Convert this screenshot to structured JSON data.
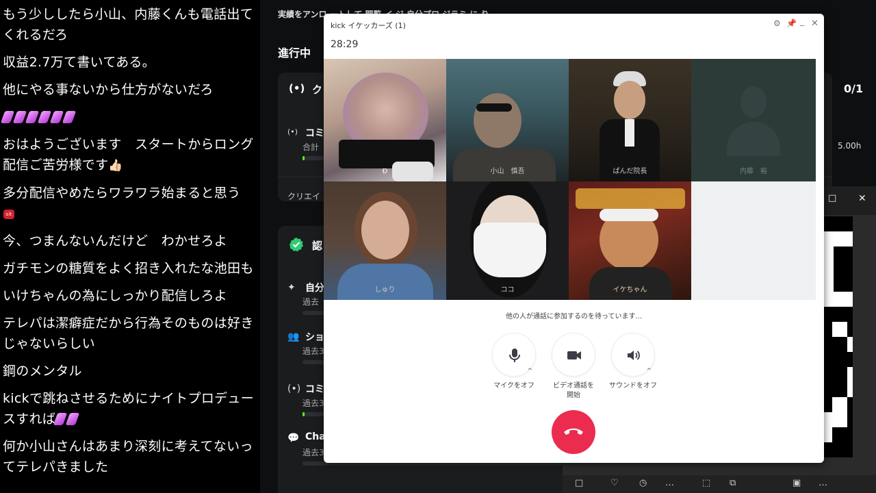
{
  "chat": {
    "messages": [
      {
        "text": "もう少ししたら小山、内藤くんも電話出てくれるだろ"
      },
      {
        "text": "収益2.7万て書いてある。"
      },
      {
        "text": "他にやる事ないから仕方がないだろ"
      },
      {
        "text": "",
        "emotes": 6
      },
      {
        "text": "おはようございます　スタートからロング配信ご苦労様です",
        "suffix": "👍🏻"
      },
      {
        "text": "多分配信やめたらワラワラ始まると思う",
        "badge": "sit"
      },
      {
        "text": "今、つまんないんだけど　わかせろよ"
      },
      {
        "text": "ガチモンの糖質をよく招き入れたな池田も"
      },
      {
        "text": "いけちゃんの為にしっかり配信しろよ"
      },
      {
        "text": "テレパは潔癖症だから行為そのものは好きじゃないらしい"
      },
      {
        "text": "鋼のメンタル"
      },
      {
        "text": "kickで跳ねさせるためにナイトプロデュースすれば",
        "trailing_emotes": 2
      },
      {
        "text": "何か小山さんはあまり深刻に考えてないってテレパきました"
      }
    ]
  },
  "dashboard": {
    "top_text": "実績をアンロ ートして 閲覧 イ ジ 自分プロ ジラミ に り",
    "section_title": "進行中",
    "card1": {
      "title_icon": "(•)",
      "title": "ク",
      "right": "0/1",
      "row_icon": "(•)",
      "row_label": "コミ",
      "row_sub": "合計",
      "row_right": "5.00h",
      "footer": "クリエイ"
    },
    "card2": {
      "title": "認",
      "rows": [
        {
          "icon": "✦",
          "label": "自分",
          "sub": "過去"
        },
        {
          "icon": "👥",
          "label": "ショ",
          "sub": "過去3"
        },
        {
          "icon": "(•)",
          "label": "コミ",
          "sub": "過去3"
        },
        {
          "icon": "💬",
          "label": "Chat",
          "sub": "過去3"
        }
      ]
    }
  },
  "call": {
    "title": "kick イケッカーズ  (1)",
    "timer": "28:29",
    "participants": [
      {
        "name": "Ð"
      },
      {
        "name": "小山　慎吾"
      },
      {
        "name": "ぱんだ院長"
      },
      {
        "name": "内藤　裕"
      },
      {
        "name": "しゅり"
      },
      {
        "name": "ココ"
      },
      {
        "name": "イケちゃん"
      }
    ],
    "waiting_text": "他の人が通話に参加するのを待っています...",
    "controls": {
      "mic_label": "マイクをオフ",
      "video_label": "ビデオ通話を\n開始",
      "sound_label": "サウンドをオフ",
      "caret": "^"
    }
  },
  "qr_window": {
    "maximize": "□",
    "close": "✕",
    "bottom_icons": [
      "□",
      "♡",
      "◷",
      "…",
      "⬚",
      "⧉",
      "▣",
      "…"
    ]
  },
  "colors": {
    "hangup": "#eb2c4e",
    "kick_green": "#53fc18",
    "verified_green": "#2ecc71"
  }
}
